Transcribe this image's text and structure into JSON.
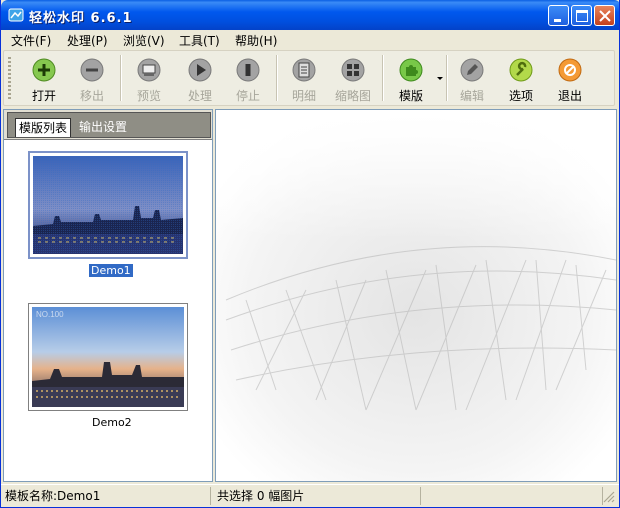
{
  "window": {
    "title": "轻松水印 6.6.1",
    "controls": [
      "minimize",
      "maximize",
      "close"
    ]
  },
  "menu": [
    {
      "label": "文件(F)"
    },
    {
      "label": "处理(P)"
    },
    {
      "label": "浏览(V)"
    },
    {
      "label": "工具(T)"
    },
    {
      "label": "帮助(H)"
    }
  ],
  "toolbar": {
    "buttons": [
      {
        "label": "打开",
        "icon": "plus-icon",
        "enabled": true,
        "color": "#7BC04A"
      },
      {
        "label": "移出",
        "icon": "minus-icon",
        "enabled": false,
        "color": "#9A9A9A"
      },
      {
        "label": "预览",
        "icon": "preview-icon",
        "enabled": false,
        "color": "#9A9A9A"
      },
      {
        "label": "处理",
        "icon": "play-icon",
        "enabled": false,
        "color": "#9A9A9A"
      },
      {
        "label": "停止",
        "icon": "stop-icon",
        "enabled": false,
        "color": "#9A9A9A"
      },
      {
        "label": "明细",
        "icon": "detail-icon",
        "enabled": false,
        "color": "#9A9A9A"
      },
      {
        "label": "缩略图",
        "icon": "thumbnails-icon",
        "enabled": false,
        "color": "#9A9A9A"
      },
      {
        "label": "模版",
        "icon": "puzzle-icon",
        "enabled": true,
        "color": "#6DBE3F"
      },
      {
        "label": "编辑",
        "icon": "pencil-icon",
        "enabled": false,
        "color": "#9A9A9A"
      },
      {
        "label": "选项",
        "icon": "wrench-icon",
        "enabled": true,
        "color": "#A5D23A"
      },
      {
        "label": "退出",
        "icon": "exit-icon",
        "enabled": true,
        "color": "#F08A24"
      }
    ]
  },
  "left_panel": {
    "tabs": [
      {
        "label": "模版列表",
        "active": true
      },
      {
        "label": "输出设置",
        "active": false
      }
    ],
    "templates": [
      {
        "label": "Demo1",
        "selected": true
      },
      {
        "label": "Demo2",
        "selected": false,
        "watermark": "NO.100"
      }
    ]
  },
  "statusbar": {
    "template_name": "模板名称:Demo1",
    "selection": "共选择 0 幅图片"
  },
  "colors": {
    "title_bar": "#0058EE",
    "selection": "#316AC5",
    "window_bg": "#ECE9D8"
  }
}
